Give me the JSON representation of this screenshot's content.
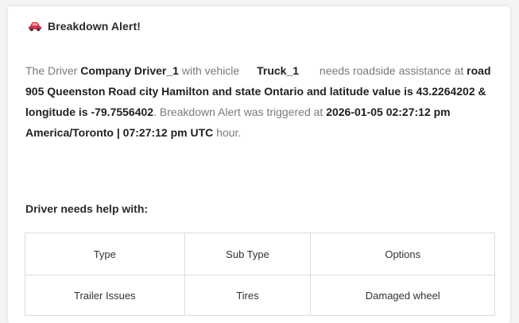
{
  "alert": {
    "title": "Breakdown Alert!",
    "icon": "car-icon",
    "icon_color": "#d9334a"
  },
  "message": {
    "p1": "The Driver ",
    "driver_name": "Company Driver_1",
    "p2": " with vehicle ",
    "vehicle": "Truck_1",
    "p3": " needs roadside assistance at ",
    "location": "road 905 Queenston Road city Hamilton and state Ontario and latitude value is 43.2264202 & longitude is -79.7556402",
    "p4": ". Breakdown Alert was triggered at ",
    "time": "2026-01-05 02:27:12 pm America/Toronto | 07:27:12 pm UTC",
    "p5": " hour."
  },
  "help": {
    "heading": "Driver needs help with:",
    "columns": [
      "Type",
      "Sub Type",
      "Options"
    ],
    "rows": [
      [
        "Trailer Issues",
        "Tires",
        "Damaged wheel"
      ]
    ]
  }
}
